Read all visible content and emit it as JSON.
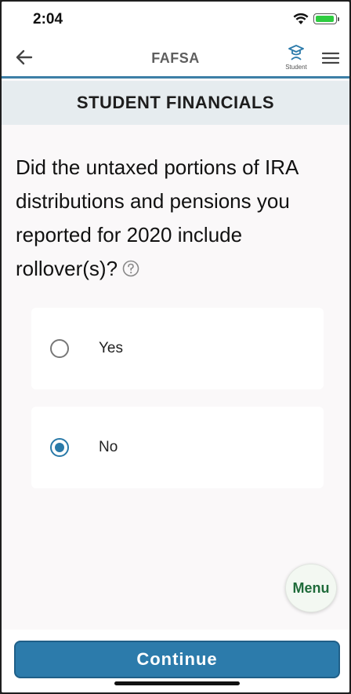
{
  "status_bar": {
    "time": "2:04",
    "icons": [
      "wifi-icon",
      "battery-icon"
    ]
  },
  "nav": {
    "title": "FAFSA",
    "back_icon": "arrow-left-icon",
    "student_label": "Student",
    "student_icon": "student-cap-icon",
    "menu_icon": "hamburger-icon"
  },
  "section": {
    "title": "STUDENT FINANCIALS"
  },
  "question": {
    "text": "Did the untaxed portions of IRA distributions and pensions you reported for 2020 include rollover(s)?",
    "help_icon": "question-circle-icon"
  },
  "options": [
    {
      "label": "Yes",
      "selected": false
    },
    {
      "label": "No",
      "selected": true
    }
  ],
  "fab": {
    "label": "Menu"
  },
  "footer": {
    "continue_label": "Continue"
  },
  "colors": {
    "accent": "#2c7bab",
    "radio_selected": "#2979a8",
    "section_bg": "#e6ecef",
    "menu_text": "#1f6b3a"
  }
}
